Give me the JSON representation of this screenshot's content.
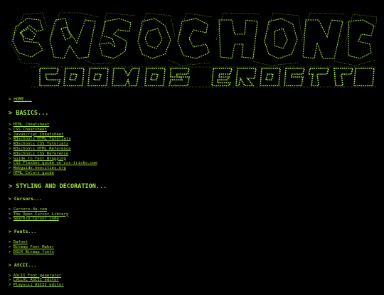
{
  "colors": {
    "background": "#000000",
    "foreground": "#a4e63a"
  },
  "banner": {
    "logo_icon": "ascii-art-banner-logo"
  },
  "arrow": ">",
  "home": {
    "label": "HOME..."
  },
  "basics": {
    "title": "BASICS...",
    "links": [
      "HTML Cheatsheet",
      "CSS Cheatsheet",
      "Javascript Cheatsheet",
      "W3schools HTML Tutorials",
      "W3schools CSS Tutorials",
      "W3schools HTML Reference",
      "W3schools CSS Reference",
      "Guide to Text Wrapping",
      "CSS Flexbox guide on css-tricks.com",
      "Webguide.neocities.org",
      "HTML Colors guide"
    ]
  },
  "styling": {
    "title": "STYLING AND DECORATION..."
  },
  "cursors": {
    "title": "Cursors...",
    "links": [
      "Cursors-4u.com",
      "The Open Cursor Library",
      "Sparkle Cursor code"
    ]
  },
  "fonts": {
    "title": "Fonts...",
    "links": [
      "Dafont",
      "Bitmap Font Maker",
      "DSG4 Bitmap fonts"
    ]
  },
  "ascii": {
    "title": "ASCII...",
    "links": [
      "ASCII Font generator",
      "LVLLVL ASCII editor",
      "Playscii ASCII editor"
    ]
  }
}
